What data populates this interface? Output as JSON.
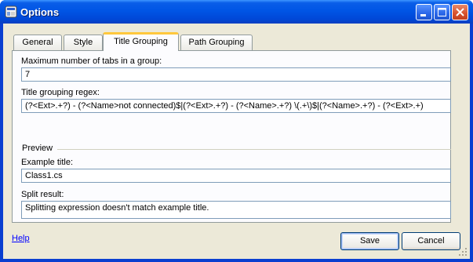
{
  "window": {
    "title": "Options",
    "icon": "settings-app-icon"
  },
  "titlebar_buttons": [
    "minimize-icon",
    "maximize-icon",
    "close-icon"
  ],
  "tabs": [
    {
      "label": "General",
      "active": false
    },
    {
      "label": "Style",
      "active": false
    },
    {
      "label": "Title Grouping",
      "active": true
    },
    {
      "label": "Path Grouping",
      "active": false
    }
  ],
  "fields": {
    "max_tabs_label": "Maximum number of tabs in a group:",
    "max_tabs_value": "7",
    "regex_label": "Title grouping regex:",
    "regex_value": "(?<Ext>.+?) - (?<Name>not connected)$|(?<Ext>.+?) - (?<Name>.+?) \\(.+\\)$|(?<Name>.+?) - (?<Ext>.+)",
    "preview_group": "Preview",
    "example_label": "Example title:",
    "example_value": "Class1.cs",
    "split_label": "Split result:",
    "split_value": "Splitting expression doesn't match example title."
  },
  "footer": {
    "help_link": "Help",
    "save_label": "Save",
    "cancel_label": "Cancel"
  },
  "colors": {
    "titlebar": "#0055e5",
    "client": "#ece9d8",
    "active_tab_accent": "#ffc83c",
    "link": "#0000ff"
  }
}
